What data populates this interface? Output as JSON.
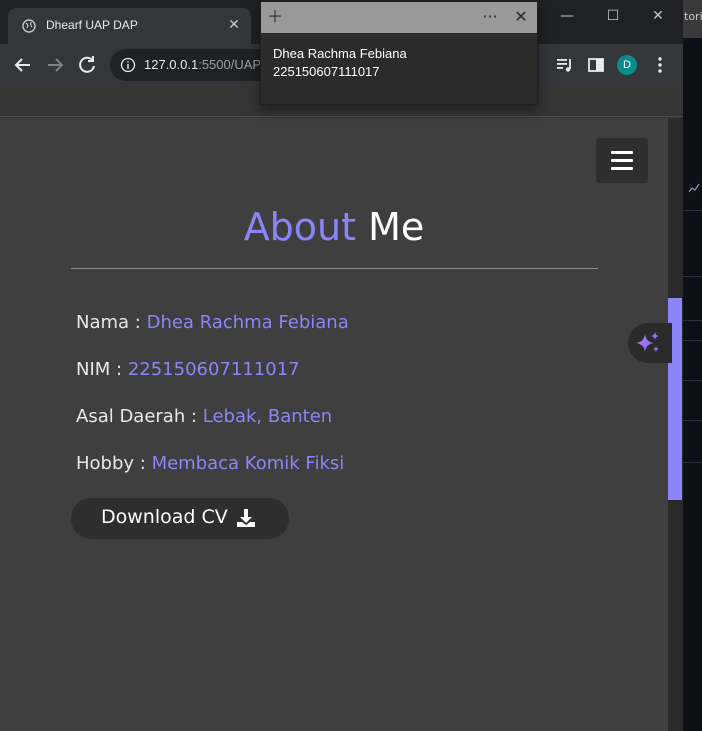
{
  "browser": {
    "tab_title": "Dhearf UAP DAP",
    "url_host": "127.0.0.1",
    "url_rest": ":5500/UAP",
    "profile_initial": "D",
    "window_buttons": [
      "—",
      "☐",
      "✕"
    ]
  },
  "background_window": {
    "title_fragment": "torial"
  },
  "popup": {
    "line1": "Dhea Rachma Febiana",
    "line2": "225150607111017",
    "more": "···"
  },
  "page": {
    "heading_accent": "About",
    "heading_plain": "Me",
    "fields": [
      {
        "label": "Nama : ",
        "value": "Dhea Rachma Febiana"
      },
      {
        "label": "NIM : ",
        "value": "225150607111017"
      },
      {
        "label": "Asal Daerah : ",
        "value": "Lebak, Banten"
      },
      {
        "label": "Hobby : ",
        "value": "Membaca Komik Fiksi"
      }
    ],
    "cv_button": "Download CV",
    "colors": {
      "accent": "#8a86f7",
      "background": "#3f3f3f",
      "button": "#2e2e2e"
    }
  },
  "icons": [
    "globe-icon",
    "close-icon",
    "back-arrow-icon",
    "forward-arrow-icon",
    "reload-icon",
    "info-icon",
    "media-queue-icon",
    "side-panel-icon",
    "more-vert-icon",
    "hamburger-menu-icon",
    "download-icon",
    "sparkle-icon",
    "plus-icon",
    "chart-icon"
  ]
}
